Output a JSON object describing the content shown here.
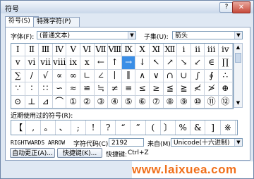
{
  "window": {
    "title": "符号",
    "help": "?",
    "close": "✕"
  },
  "tabs": [
    {
      "label": "符号(S)"
    },
    {
      "label": "特殊字符(P)"
    }
  ],
  "font": {
    "label": "字体(F):",
    "value": "(普通文本)"
  },
  "subset": {
    "label": "子集(U):",
    "value": "箭头"
  },
  "symbols": [
    [
      "Ⅰ",
      "Ⅱ",
      "Ⅲ",
      "Ⅳ",
      "Ⅴ",
      "Ⅵ",
      "Ⅶ",
      "Ⅷ",
      "Ⅸ",
      "Ⅹ",
      "Ⅺ",
      "Ⅻ",
      "ⅰ",
      "ⅱ",
      "ⅲ",
      "ⅳ"
    ],
    [
      "ⅴ",
      "ⅵ",
      "ⅶ",
      "ⅷ",
      "ⅸ",
      "ⅹ",
      "←",
      "↑",
      "→",
      "↓",
      "↖",
      "↗",
      "↘",
      "↙",
      "∈",
      "∏"
    ],
    [
      "∑",
      "/",
      "√",
      "∝",
      "∞",
      "∟",
      "∠",
      "∣",
      "∥",
      "∧",
      "∨",
      "∩",
      "∪",
      "∫",
      "∮",
      "∴"
    ],
    [
      "∵",
      "∶",
      "∷",
      "∽",
      "≈",
      "≌",
      "≒",
      "≠",
      "≡",
      "≤",
      "≥",
      "≦",
      "≧",
      "≮",
      "≯",
      "⊕"
    ],
    [
      "⊙",
      "⊥",
      "⊿",
      "⌒",
      "①",
      "②",
      "③",
      "④",
      "⑤",
      "⑥",
      "⑦",
      "⑧",
      "⑨",
      "⑩",
      "⑪",
      "⑫"
    ]
  ],
  "selected": {
    "row": 1,
    "col": 8
  },
  "recent": {
    "label": "近期使用过的符号(R):",
    "items": [
      "【",
      ",",
      "。",
      "、",
      ";",
      "!",
      "?",
      "“",
      "”",
      "(",
      "〕",
      "%",
      "&",
      "]",
      "※"
    ]
  },
  "char_name": "RIGHTWARDS ARROW",
  "char_code": {
    "label": "字符代码(C):",
    "value": "2192"
  },
  "from": {
    "label": "来自(M):",
    "value": "Unicode(十六进制)"
  },
  "buttons": {
    "autocorrect": "自动更正(A)...",
    "shortcut_key": "快捷键(K)..."
  },
  "shortcut": {
    "label": "快捷键:",
    "value": "Ctrl+Z"
  },
  "watermark": "www.laixuea.com"
}
